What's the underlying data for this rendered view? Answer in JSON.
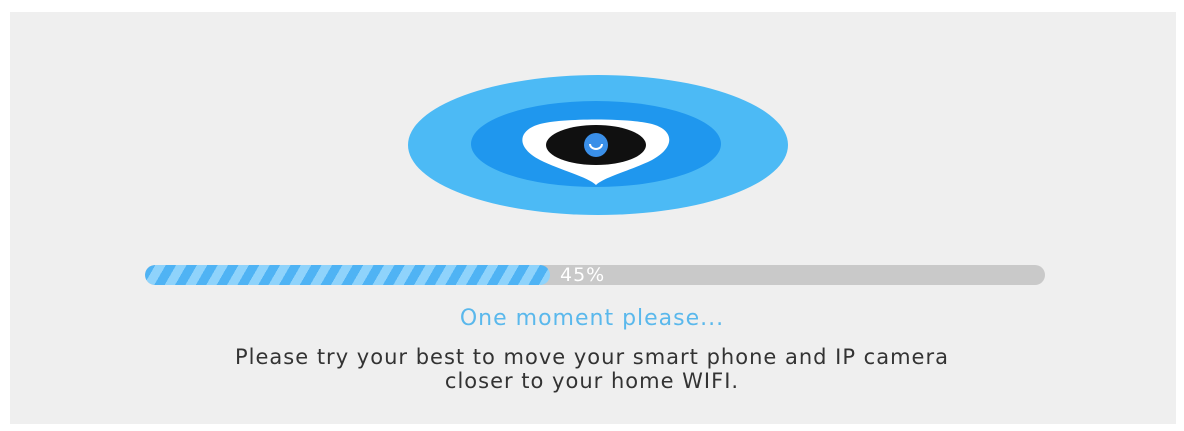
{
  "progress": {
    "value": 0.45,
    "label": "45%"
  },
  "status_text": "One moment please...",
  "hint_text": "Please try your best to move your smart phone and IP camera closer to your home WIFI.",
  "hint_line1": "Please try your best to move your smart phone and IP camera",
  "hint_line2": "closer to your home WIFI.",
  "illustration": {
    "icon": "camera-location-pin-icon",
    "colors": {
      "outer": "#4cbaf5",
      "inner": "#1f97ee",
      "pin": "#ffffff",
      "lens": "#101010",
      "lens_center": "#3a8fe8"
    }
  },
  "colors": {
    "background": "#efefef",
    "accent": "#5ab8ec",
    "progress_track": "#c9c9c9",
    "progress_fill": "#4fb3f4"
  }
}
